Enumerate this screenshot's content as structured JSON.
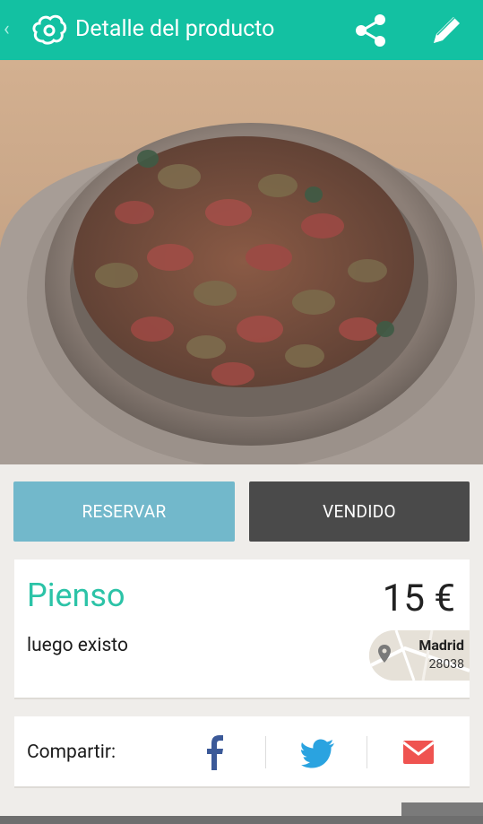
{
  "appbar": {
    "title": "Detalle del producto",
    "back_icon": "chevron-left-icon",
    "logo_icon": "cloud-logo-icon",
    "share_icon": "share-icon",
    "edit_icon": "pencil-icon",
    "color": "#13c1a2"
  },
  "gallery": {
    "image": "dog-food-bowl-photo",
    "pages": 1,
    "current": 1
  },
  "actions": {
    "reserve_label": "RESERVAR",
    "sold_label": "VENDIDO",
    "reserve_color": "#72b8cb",
    "sold_color": "#4a4a4a"
  },
  "product": {
    "name": "Pienso",
    "price": "15 €",
    "description": "luego existo",
    "location": {
      "city": "Madrid",
      "zip": "28038",
      "icon": "map-pin-icon"
    }
  },
  "share": {
    "label": "Compartir:",
    "icons": [
      "facebook-icon",
      "twitter-icon",
      "email-icon"
    ]
  }
}
